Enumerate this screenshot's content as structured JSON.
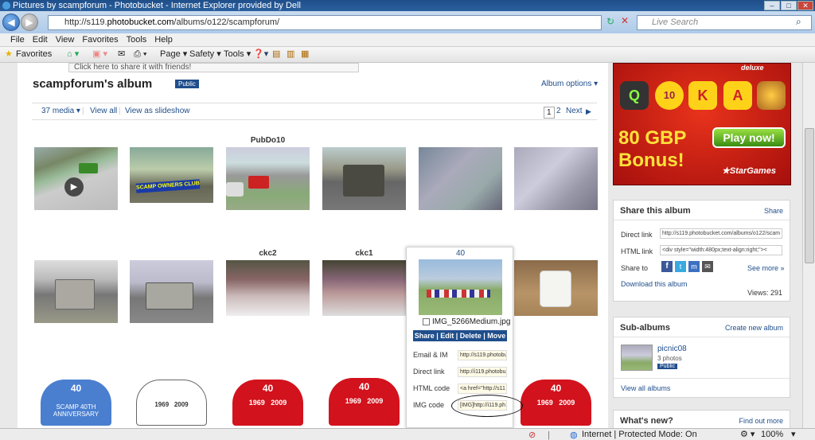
{
  "browser": {
    "window_title": "Pictures by scampforum - Photobucket - Internet Explorer provided by Dell",
    "address_prefix": "http://s119.",
    "address_domain": "photobucket.com",
    "address_path": "/albums/o122/scampforum/",
    "search_placeholder": "Live Search",
    "menu": [
      "File",
      "Edit",
      "View",
      "Favorites",
      "Tools",
      "Help"
    ],
    "favorites_label": "Favorites",
    "cmd_page": "Page",
    "cmd_safety": "Safety",
    "cmd_tools": "Tools"
  },
  "page": {
    "promo_text": "Click here to share it with friends!",
    "album_title": "scampforum's album",
    "public_badge": "Public",
    "album_options": "Album options ▾",
    "media_count": "37 media ▾",
    "view_all": "View all",
    "view_slideshow": "View as slideshow",
    "page_current": "1",
    "page_next_num": "2",
    "next_label": "Next"
  },
  "captions": {
    "r1c3": "PubDo10",
    "r2c3": "ckc2",
    "r2c4": "ckc1"
  },
  "popup": {
    "title": "40",
    "filename": "IMG_5266Medium.jpg",
    "actions": "Share | Edit | Delete | Move",
    "email_label": "Email & IM",
    "email_value": "http://s119.photobu",
    "direct_label": "Direct link",
    "direct_value": "http://i119.photobu",
    "html_label": "HTML code",
    "html_value": "<a href=\"http://s11",
    "img_label": "IMG code",
    "img_value": "[IMG]http://i119.ph"
  },
  "badges": {
    "number": "40",
    "y1": "1969",
    "y2": "2009",
    "s": "S",
    "text": "SCAMP 40TH ANNIVERSARY"
  },
  "ad": {
    "amount": "80 GBP",
    "bonus": "Bonus!",
    "play": "Play now!",
    "brand": "★StarGames",
    "letters": [
      "Q",
      "10",
      "K",
      "A"
    ],
    "deluxe": "deluxe"
  },
  "share": {
    "title": "Share this album",
    "link": "Share",
    "direct_label": "Direct link",
    "direct_value": "http://s119.photobucket.com/albums/o122/scam",
    "html_label": "HTML link",
    "html_value": "<div style=\"width:480px;text-align:right;\"><",
    "share_to": "Share to",
    "see_more": "See more »",
    "download": "Download this album",
    "views": "Views: 291"
  },
  "subalbums": {
    "title": "Sub-albums",
    "create": "Create new album",
    "name": "picnic08",
    "count": "3 photos",
    "badge": "Public",
    "view_all": "View all albums"
  },
  "whatsnew": {
    "title": "What's new?",
    "link": "Find out more"
  },
  "status": {
    "zone": "Internet | Protected Mode: On",
    "zoom": "100%"
  },
  "colors": {
    "accent": "#1f4e8c",
    "ad_red": "#c8190f",
    "badge_red": "#d2121c",
    "badge_blue": "#4a7fd0"
  }
}
